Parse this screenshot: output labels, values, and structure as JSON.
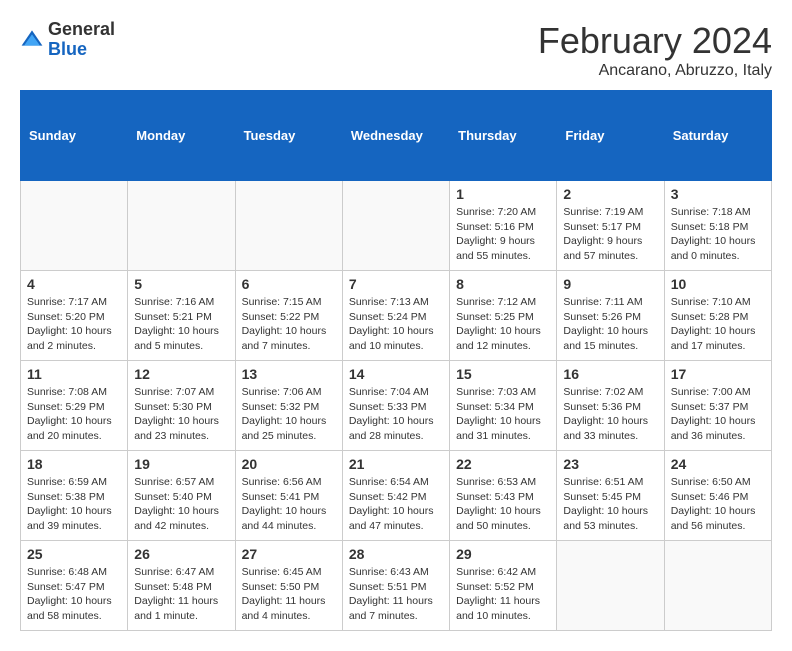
{
  "header": {
    "logo_general": "General",
    "logo_blue": "Blue",
    "month_title": "February 2024",
    "location": "Ancarano, Abruzzo, Italy"
  },
  "calendar": {
    "days_of_week": [
      "Sunday",
      "Monday",
      "Tuesday",
      "Wednesday",
      "Thursday",
      "Friday",
      "Saturday"
    ],
    "weeks": [
      [
        {
          "day": "",
          "info": ""
        },
        {
          "day": "",
          "info": ""
        },
        {
          "day": "",
          "info": ""
        },
        {
          "day": "",
          "info": ""
        },
        {
          "day": "1",
          "info": "Sunrise: 7:20 AM\nSunset: 5:16 PM\nDaylight: 9 hours and 55 minutes."
        },
        {
          "day": "2",
          "info": "Sunrise: 7:19 AM\nSunset: 5:17 PM\nDaylight: 9 hours and 57 minutes."
        },
        {
          "day": "3",
          "info": "Sunrise: 7:18 AM\nSunset: 5:18 PM\nDaylight: 10 hours and 0 minutes."
        }
      ],
      [
        {
          "day": "4",
          "info": "Sunrise: 7:17 AM\nSunset: 5:20 PM\nDaylight: 10 hours and 2 minutes."
        },
        {
          "day": "5",
          "info": "Sunrise: 7:16 AM\nSunset: 5:21 PM\nDaylight: 10 hours and 5 minutes."
        },
        {
          "day": "6",
          "info": "Sunrise: 7:15 AM\nSunset: 5:22 PM\nDaylight: 10 hours and 7 minutes."
        },
        {
          "day": "7",
          "info": "Sunrise: 7:13 AM\nSunset: 5:24 PM\nDaylight: 10 hours and 10 minutes."
        },
        {
          "day": "8",
          "info": "Sunrise: 7:12 AM\nSunset: 5:25 PM\nDaylight: 10 hours and 12 minutes."
        },
        {
          "day": "9",
          "info": "Sunrise: 7:11 AM\nSunset: 5:26 PM\nDaylight: 10 hours and 15 minutes."
        },
        {
          "day": "10",
          "info": "Sunrise: 7:10 AM\nSunset: 5:28 PM\nDaylight: 10 hours and 17 minutes."
        }
      ],
      [
        {
          "day": "11",
          "info": "Sunrise: 7:08 AM\nSunset: 5:29 PM\nDaylight: 10 hours and 20 minutes."
        },
        {
          "day": "12",
          "info": "Sunrise: 7:07 AM\nSunset: 5:30 PM\nDaylight: 10 hours and 23 minutes."
        },
        {
          "day": "13",
          "info": "Sunrise: 7:06 AM\nSunset: 5:32 PM\nDaylight: 10 hours and 25 minutes."
        },
        {
          "day": "14",
          "info": "Sunrise: 7:04 AM\nSunset: 5:33 PM\nDaylight: 10 hours and 28 minutes."
        },
        {
          "day": "15",
          "info": "Sunrise: 7:03 AM\nSunset: 5:34 PM\nDaylight: 10 hours and 31 minutes."
        },
        {
          "day": "16",
          "info": "Sunrise: 7:02 AM\nSunset: 5:36 PM\nDaylight: 10 hours and 33 minutes."
        },
        {
          "day": "17",
          "info": "Sunrise: 7:00 AM\nSunset: 5:37 PM\nDaylight: 10 hours and 36 minutes."
        }
      ],
      [
        {
          "day": "18",
          "info": "Sunrise: 6:59 AM\nSunset: 5:38 PM\nDaylight: 10 hours and 39 minutes."
        },
        {
          "day": "19",
          "info": "Sunrise: 6:57 AM\nSunset: 5:40 PM\nDaylight: 10 hours and 42 minutes."
        },
        {
          "day": "20",
          "info": "Sunrise: 6:56 AM\nSunset: 5:41 PM\nDaylight: 10 hours and 44 minutes."
        },
        {
          "day": "21",
          "info": "Sunrise: 6:54 AM\nSunset: 5:42 PM\nDaylight: 10 hours and 47 minutes."
        },
        {
          "day": "22",
          "info": "Sunrise: 6:53 AM\nSunset: 5:43 PM\nDaylight: 10 hours and 50 minutes."
        },
        {
          "day": "23",
          "info": "Sunrise: 6:51 AM\nSunset: 5:45 PM\nDaylight: 10 hours and 53 minutes."
        },
        {
          "day": "24",
          "info": "Sunrise: 6:50 AM\nSunset: 5:46 PM\nDaylight: 10 hours and 56 minutes."
        }
      ],
      [
        {
          "day": "25",
          "info": "Sunrise: 6:48 AM\nSunset: 5:47 PM\nDaylight: 10 hours and 58 minutes."
        },
        {
          "day": "26",
          "info": "Sunrise: 6:47 AM\nSunset: 5:48 PM\nDaylight: 11 hours and 1 minute."
        },
        {
          "day": "27",
          "info": "Sunrise: 6:45 AM\nSunset: 5:50 PM\nDaylight: 11 hours and 4 minutes."
        },
        {
          "day": "28",
          "info": "Sunrise: 6:43 AM\nSunset: 5:51 PM\nDaylight: 11 hours and 7 minutes."
        },
        {
          "day": "29",
          "info": "Sunrise: 6:42 AM\nSunset: 5:52 PM\nDaylight: 11 hours and 10 minutes."
        },
        {
          "day": "",
          "info": ""
        },
        {
          "day": "",
          "info": ""
        }
      ]
    ]
  }
}
